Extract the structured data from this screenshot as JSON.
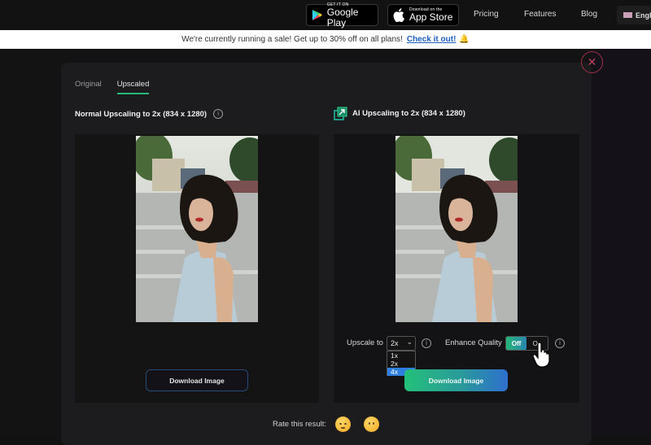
{
  "topbar": {
    "google_play": {
      "small": "GET IT ON",
      "big": "Google Play"
    },
    "app_store": {
      "small": "Download on the",
      "big": "App Store"
    },
    "nav": [
      "Pricing",
      "Features",
      "Blog"
    ],
    "language": "Engli"
  },
  "banner": {
    "text": "We're currently running a sale! Get up to 30% off on all plans!",
    "link": "Check it out!",
    "emoji": "🔔"
  },
  "modal": {
    "tabs": [
      {
        "label": "Original",
        "active": false
      },
      {
        "label": "Upscaled",
        "active": true
      }
    ],
    "left": {
      "heading": "Normal Upscaling to 2x (834 x 1280)",
      "download_label": "Download Image"
    },
    "right": {
      "heading": "AI Upscaling to 2x (834 x 1280)",
      "upscale_label": "Upscale to",
      "upscale_value": "2x",
      "upscale_options": [
        "1x",
        "2x",
        "4x"
      ],
      "upscale_highlighted": "4x",
      "enhance_label": "Enhance Quality",
      "toggle_off": "Off",
      "toggle_on": "On",
      "toggle_state": "Off",
      "download_label": "Download Image"
    },
    "rate_label": "Rate this result:",
    "close_symbol": "✕",
    "info_symbol": "i"
  },
  "colors": {
    "accent_green": "#25b878",
    "accent_blue": "#2e6fcf",
    "close_red": "#a0304a",
    "link_blue": "#1e5fbf"
  }
}
